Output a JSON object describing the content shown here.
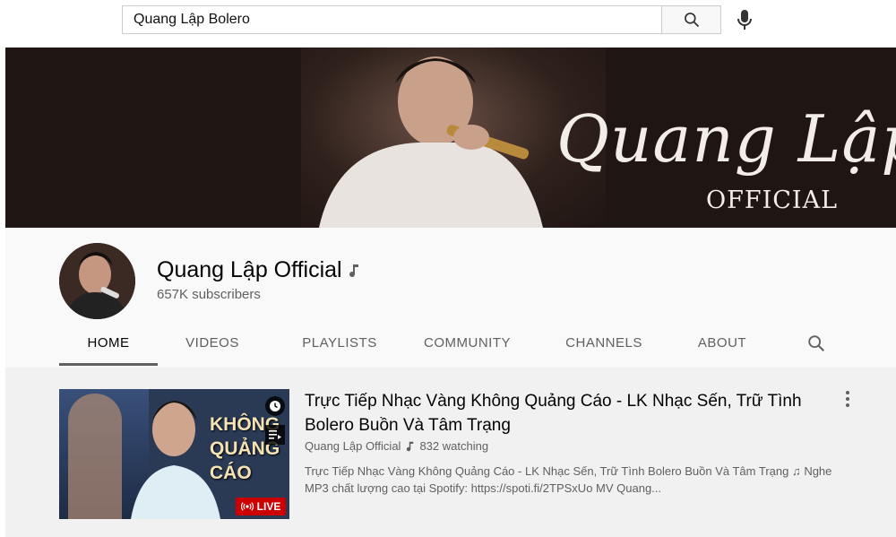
{
  "search": {
    "query": "Quang Lập Bolero"
  },
  "banner": {
    "title": "Quang Lập",
    "subtitle": "OFFICIAL"
  },
  "channel": {
    "name": "Quang Lập Official",
    "subscribers": "657K subscribers"
  },
  "tabs": [
    {
      "label": "HOME",
      "active": true
    },
    {
      "label": "VIDEOS"
    },
    {
      "label": "PLAYLISTS"
    },
    {
      "label": "COMMUNITY"
    },
    {
      "label": "CHANNELS"
    },
    {
      "label": "ABOUT"
    }
  ],
  "video": {
    "title": "Trực Tiếp Nhạc Vàng Không Quảng Cáo - LK Nhạc Sến, Trữ Tình Bolero Buồn Và Tâm Trạng",
    "channel": "Quang Lập Official",
    "watching": "832 watching",
    "description": "Trực Tiếp Nhạc Vàng Không Quảng Cáo - LK Nhạc Sến, Trữ Tình Bolero Buồn Và Tâm Trạng ♫ Nghe MP3 chất lượng cao tại Spotify: https://spoti.fi/2TPSxUo MV Quang...",
    "thumbnail_text": [
      "KHÔNG",
      "QUẢNG",
      "CÁO"
    ],
    "live_label": "LIVE"
  },
  "colors": {
    "live_red": "#cc0000",
    "text_secondary": "#606060",
    "banner_bg": "#1f1513"
  },
  "icons": [
    "search-icon",
    "microphone-icon",
    "music-note-icon",
    "clock-icon",
    "add-to-queue-icon",
    "live-broadcast-icon",
    "more-vertical-icon"
  ]
}
